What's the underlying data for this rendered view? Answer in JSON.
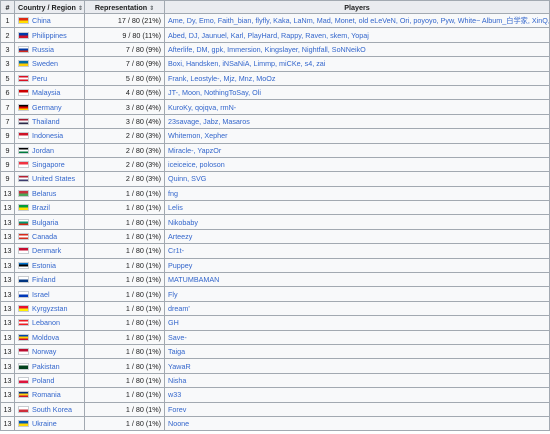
{
  "table": {
    "headers": [
      "#",
      "Country / Region",
      "Representation",
      "Players"
    ],
    "rows": [
      {
        "rank": "1",
        "country": "China",
        "rep": "17 / 80 (21%)",
        "players": "Ame, Dy, Emo, Faith_bian, flyfly, Kaka, LaNm, Mad, Monet, old eLeVeN, Ori, poyoyo, Pyw, White~ Album_白学家, XinQ, Xxs, y`",
        "flag": [
          "#de2910",
          "#ffde00"
        ]
      },
      {
        "rank": "2",
        "country": "Philippines",
        "rep": "9 / 80 (11%)",
        "players": "Abed, DJ, Jaunuel, Karl, PlayHard, Rappy, Raven, skem, Yopaj",
        "flag": [
          "#0038a8",
          "#ce1126"
        ]
      },
      {
        "rank": "3",
        "country": "Russia",
        "rep": "7 / 80 (9%)",
        "players": "Afterlife, DM, gpk, Immersion, Kingslayer, Nightfall, SoNNeikO",
        "flag": [
          "#ffffff",
          "#0039a6",
          "#d52b1e"
        ]
      },
      {
        "rank": "3",
        "country": "Sweden",
        "rep": "7 / 80 (9%)",
        "players": "Boxi, Handsken, iNSaNiA, Limmp, miCKe, s4, zai",
        "flag": [
          "#006aa7",
          "#fecc00"
        ]
      },
      {
        "rank": "5",
        "country": "Peru",
        "rep": "5 / 80 (6%)",
        "players": "Frank, Leostyle-, Mjz, Mnz, MoOz",
        "flag": [
          "#d91023",
          "#ffffff",
          "#d91023"
        ]
      },
      {
        "rank": "6",
        "country": "Malaysia",
        "rep": "4 / 80 (5%)",
        "players": "JT-, Moon, NothingToSay, Oli",
        "flag": [
          "#cc0001",
          "#ffffff"
        ]
      },
      {
        "rank": "7",
        "country": "Germany",
        "rep": "3 / 80 (4%)",
        "players": "KuroKy, qojqva, rmN-",
        "flag": [
          "#000000",
          "#dd0000",
          "#ffce00"
        ]
      },
      {
        "rank": "7",
        "country": "Thailand",
        "rep": "3 / 80 (4%)",
        "players": "23savage, Jabz, Masaros",
        "flag": [
          "#a51931",
          "#f4f5f8",
          "#2d2a4a"
        ]
      },
      {
        "rank": "9",
        "country": "Indonesia",
        "rep": "2 / 80 (3%)",
        "players": "Whitemon, Xepher",
        "flag": [
          "#ce1126",
          "#ffffff"
        ]
      },
      {
        "rank": "9",
        "country": "Jordan",
        "rep": "2 / 80 (3%)",
        "players": "Miracle-, YapzOr",
        "flag": [
          "#000000",
          "#ffffff",
          "#007a3d"
        ]
      },
      {
        "rank": "9",
        "country": "Singapore",
        "rep": "2 / 80 (3%)",
        "players": "iceiceice, poloson",
        "flag": [
          "#ef3340",
          "#ffffff"
        ]
      },
      {
        "rank": "9",
        "country": "United States",
        "rep": "2 / 80 (3%)",
        "players": "Quinn, SVG",
        "flag": [
          "#b22234",
          "#ffffff",
          "#3c3b6e"
        ]
      },
      {
        "rank": "13",
        "country": "Belarus",
        "rep": "1 / 80 (1%)",
        "players": "fng",
        "flag": [
          "#c8313e",
          "#4aa657"
        ]
      },
      {
        "rank": "13",
        "country": "Brazil",
        "rep": "1 / 80 (1%)",
        "players": "Lelis",
        "flag": [
          "#009c3b",
          "#ffdf00"
        ]
      },
      {
        "rank": "13",
        "country": "Bulgaria",
        "rep": "1 / 80 (1%)",
        "players": "Nikobaby",
        "flag": [
          "#ffffff",
          "#00966e",
          "#d62612"
        ]
      },
      {
        "rank": "13",
        "country": "Canada",
        "rep": "1 / 80 (1%)",
        "players": "Arteezy",
        "flag": [
          "#d52b1e",
          "#ffffff",
          "#d52b1e"
        ]
      },
      {
        "rank": "13",
        "country": "Denmark",
        "rep": "1 / 80 (1%)",
        "players": "Cr1t-",
        "flag": [
          "#c60c30",
          "#ffffff"
        ]
      },
      {
        "rank": "13",
        "country": "Estonia",
        "rep": "1 / 80 (1%)",
        "players": "Puppey",
        "flag": [
          "#0072ce",
          "#000000",
          "#ffffff"
        ]
      },
      {
        "rank": "13",
        "country": "Finland",
        "rep": "1 / 80 (1%)",
        "players": "MATUMBAMAN",
        "flag": [
          "#ffffff",
          "#003580"
        ]
      },
      {
        "rank": "13",
        "country": "Israel",
        "rep": "1 / 80 (1%)",
        "players": "Fly",
        "flag": [
          "#ffffff",
          "#0038b8"
        ]
      },
      {
        "rank": "13",
        "country": "Kyrgyzstan",
        "rep": "1 / 80 (1%)",
        "players": "dream'",
        "flag": [
          "#e8112d",
          "#ffef00"
        ]
      },
      {
        "rank": "13",
        "country": "Lebanon",
        "rep": "1 / 80 (1%)",
        "players": "GH",
        "flag": [
          "#ed1c24",
          "#ffffff",
          "#ed1c24"
        ]
      },
      {
        "rank": "13",
        "country": "Moldova",
        "rep": "1 / 80 (1%)",
        "players": "Save-",
        "flag": [
          "#0046ae",
          "#ffd200",
          "#cc092f"
        ]
      },
      {
        "rank": "13",
        "country": "Norway",
        "rep": "1 / 80 (1%)",
        "players": "Taiga",
        "flag": [
          "#ba0c2f",
          "#ffffff"
        ]
      },
      {
        "rank": "13",
        "country": "Pakistan",
        "rep": "1 / 80 (1%)",
        "players": "YawaR",
        "flag": [
          "#ffffff",
          "#01411c",
          "#01411c"
        ]
      },
      {
        "rank": "13",
        "country": "Poland",
        "rep": "1 / 80 (1%)",
        "players": "Nisha",
        "flag": [
          "#ffffff",
          "#dc143c"
        ]
      },
      {
        "rank": "13",
        "country": "Romania",
        "rep": "1 / 80 (1%)",
        "players": "w33",
        "flag": [
          "#002b7f",
          "#fcd116",
          "#ce1126"
        ]
      },
      {
        "rank": "13",
        "country": "South Korea",
        "rep": "1 / 80 (1%)",
        "players": "Forev",
        "flag": [
          "#ffffff",
          "#cd2e3a"
        ]
      },
      {
        "rank": "13",
        "country": "Ukraine",
        "rep": "1 / 80 (1%)",
        "players": "Noone",
        "flag": [
          "#0057b7",
          "#ffd700"
        ]
      }
    ]
  }
}
